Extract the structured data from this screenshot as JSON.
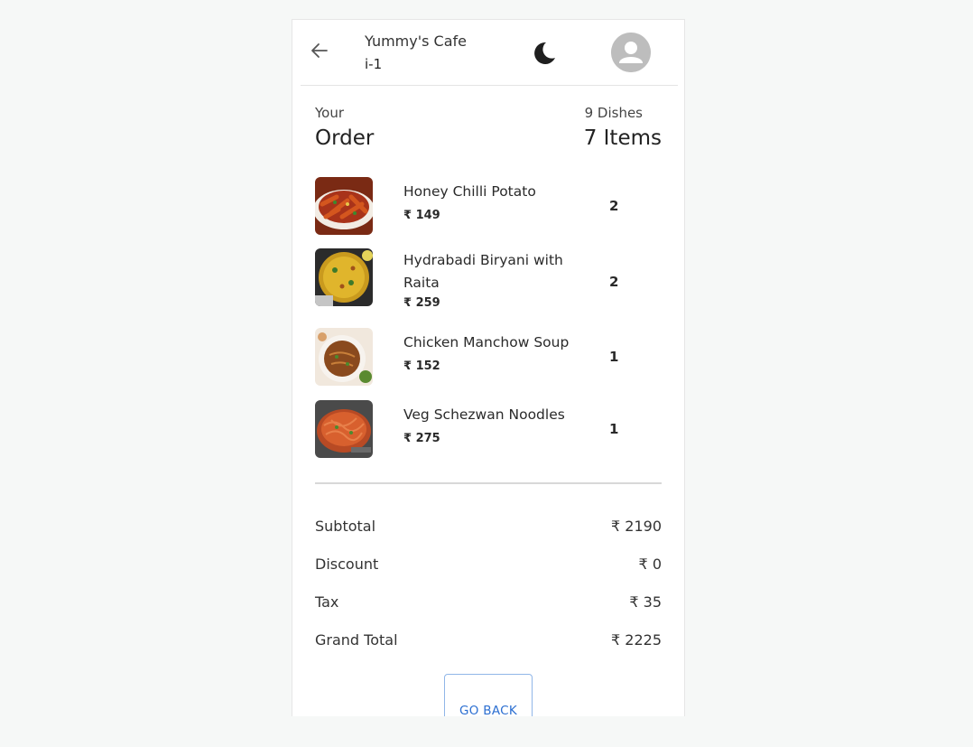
{
  "header": {
    "cafe_name": "Yummy's Cafe",
    "table_id": "i-1",
    "back_icon": "arrow-left-icon",
    "theme_icon": "moon-icon",
    "profile_icon": "account-circle-icon"
  },
  "order": {
    "label": "Your",
    "title": "Order",
    "dishes": "9 Dishes",
    "items": "7 Items"
  },
  "items": [
    {
      "name": "Honey Chilli Potato",
      "price": "₹ 149",
      "qty": "2"
    },
    {
      "name": "Hydrabadi Biryani with Raita",
      "price": "₹ 259",
      "qty": "2"
    },
    {
      "name": "Chicken Manchow Soup",
      "price": "₹ 152",
      "qty": "1"
    },
    {
      "name": "Veg Schezwan Noodles",
      "price": "₹ 275",
      "qty": "1"
    }
  ],
  "summary": {
    "subtotal_label": "Subtotal",
    "subtotal": "₹ 2190",
    "discount_label": "Discount",
    "discount": "₹ 0",
    "tax_label": "Tax",
    "tax": "₹ 35",
    "grand_total_label": "Grand Total",
    "grand_total": "₹ 2225"
  },
  "actions": {
    "go_back": "GO BACK"
  },
  "colors": {
    "background": "#f6f8f7",
    "accent": "#2c6fd1",
    "avatar": "#bdbdbd"
  }
}
